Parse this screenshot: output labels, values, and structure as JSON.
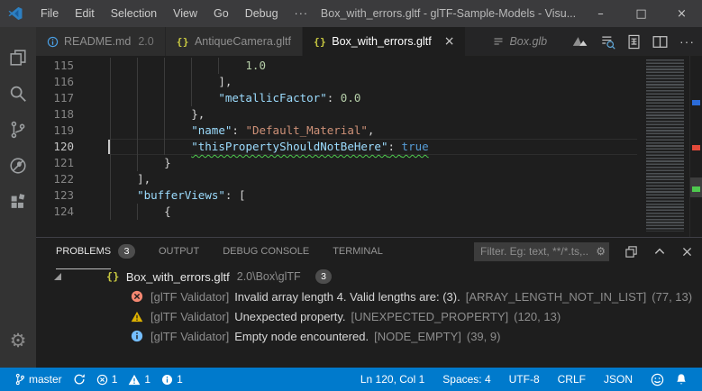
{
  "colors": {
    "accent": "#007acc",
    "editor_bg": "#1e1e1e",
    "titlebar_bg": "#3b3b3d",
    "squiggle_green": "#4ec94e",
    "error_red": "#f48771",
    "warning_yellow": "#ddb100",
    "info_blue": "#75beff"
  },
  "titlebar": {
    "app_title": "Box_with_errors.gltf - glTF-Sample-Models - Visu...",
    "menus": [
      "File",
      "Edit",
      "Selection",
      "View",
      "Go",
      "Debug"
    ],
    "menu_overflow": "···",
    "controls": {
      "minimize": "–",
      "maximize": "□",
      "close": "×"
    }
  },
  "tabs": [
    {
      "label": "README.md",
      "detail": "2.0"
    },
    {
      "label": "AntiqueCamera.gltf",
      "icon_glyph": "{}"
    },
    {
      "label": "Box_with_errors.gltf",
      "icon_glyph": "{}",
      "close": "×"
    },
    {
      "label": "Box.glb"
    }
  ],
  "editor_actions": {
    "more": "···"
  },
  "editor": {
    "lines": [
      {
        "num": "115",
        "indent": 20,
        "guides": [
          0,
          4,
          8,
          12,
          16
        ],
        "segments": [
          {
            "c": "num",
            "t": "1.0"
          }
        ]
      },
      {
        "num": "116",
        "indent": 16,
        "guides": [
          0,
          4,
          8,
          12
        ],
        "segments": [
          {
            "c": "punct",
            "t": "],"
          }
        ]
      },
      {
        "num": "117",
        "indent": 16,
        "guides": [
          0,
          4,
          8,
          12
        ],
        "segments": [
          {
            "c": "key",
            "t": "\"metallicFactor\""
          },
          {
            "c": "punct",
            "t": ": "
          },
          {
            "c": "num",
            "t": "0.0"
          }
        ]
      },
      {
        "num": "118",
        "indent": 12,
        "guides": [
          0,
          4,
          8
        ],
        "segments": [
          {
            "c": "punct",
            "t": "},"
          }
        ]
      },
      {
        "num": "119",
        "indent": 12,
        "guides": [
          0,
          4,
          8
        ],
        "segments": [
          {
            "c": "key",
            "t": "\"name\""
          },
          {
            "c": "punct",
            "t": ": "
          },
          {
            "c": "str",
            "t": "\"Default_Material\""
          },
          {
            "c": "punct",
            "t": ","
          }
        ]
      },
      {
        "num": "120",
        "indent": 12,
        "guides": [
          0,
          4,
          8
        ],
        "current": true,
        "cursor": true,
        "squiggle": true,
        "segments": [
          {
            "c": "key",
            "t": "\"thisPropertyShouldNotBeHere\""
          },
          {
            "c": "punct",
            "t": ": "
          },
          {
            "c": "bool",
            "t": "true"
          }
        ]
      },
      {
        "num": "121",
        "indent": 8,
        "guides": [
          0,
          4
        ],
        "segments": [
          {
            "c": "punct",
            "t": "}"
          }
        ]
      },
      {
        "num": "122",
        "indent": 4,
        "guides": [
          0
        ],
        "segments": [
          {
            "c": "punct",
            "t": "],"
          }
        ]
      },
      {
        "num": "123",
        "indent": 4,
        "guides": [
          0
        ],
        "segments": [
          {
            "c": "key",
            "t": "\"bufferViews\""
          },
          {
            "c": "punct",
            "t": ": "
          },
          {
            "c": "punct",
            "t": "["
          }
        ]
      },
      {
        "num": "124",
        "indent": 8,
        "guides": [
          0,
          4
        ],
        "segments": [
          {
            "c": "punct",
            "t": "{"
          }
        ]
      }
    ]
  },
  "panel": {
    "tabs": [
      {
        "label": "PROBLEMS",
        "badge": "3"
      },
      {
        "label": "OUTPUT"
      },
      {
        "label": "DEBUG CONSOLE"
      },
      {
        "label": "TERMINAL"
      }
    ],
    "filter_placeholder": "Filter. Eg: text, **/*.ts,...",
    "file_group": {
      "name": "Box_with_errors.gltf",
      "path": "2.0\\Box\\glTF",
      "badge": "3"
    },
    "problems": [
      {
        "severity": "error",
        "source": "[glTF Validator]",
        "message": "Invalid array length 4. Valid lengths are: (3).",
        "code": "[ARRAY_LENGTH_NOT_IN_LIST]",
        "position": "(77, 13)"
      },
      {
        "severity": "warning",
        "source": "[glTF Validator]",
        "message": "Unexpected property.",
        "code": "[UNEXPECTED_PROPERTY]",
        "position": "(120, 13)"
      },
      {
        "severity": "info",
        "source": "[glTF Validator]",
        "message": "Empty node encountered.",
        "code": "[NODE_EMPTY]",
        "position": "(39, 9)"
      }
    ]
  },
  "statusbar": {
    "branch": "master",
    "errors": "1",
    "warnings": "1",
    "infos": "1",
    "line_col": "Ln 120, Col 1",
    "indent": "Spaces: 4",
    "encoding": "UTF-8",
    "eol": "CRLF",
    "language": "JSON"
  }
}
